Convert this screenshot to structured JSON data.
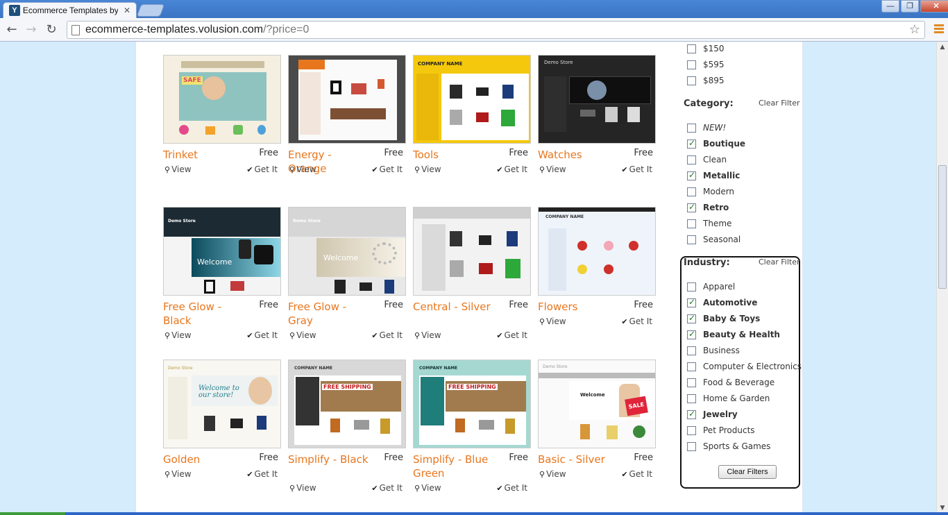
{
  "browser": {
    "tab_title": "Ecommerce Templates by Vol",
    "tab_icon": "Y",
    "tab_close": "✕",
    "url_host": "ecommerce-templates.volusion.com",
    "url_path": "/?price=0",
    "window_controls": [
      "—",
      "❐",
      "✕"
    ]
  },
  "templates": [
    {
      "name": "Trinket",
      "price": "Free",
      "view": "View",
      "getit": "Get It",
      "theme": "trinket"
    },
    {
      "name": "Energy - Orange",
      "price": "Free",
      "view": "View",
      "getit": "Get It",
      "theme": "energy"
    },
    {
      "name": "Tools",
      "price": "Free",
      "view": "View",
      "getit": "Get It",
      "theme": "tools"
    },
    {
      "name": "Watches",
      "price": "Free",
      "view": "View",
      "getit": "Get It",
      "theme": "watches"
    },
    {
      "name": "Free Glow - Black",
      "price": "Free",
      "view": "View",
      "getit": "Get It",
      "theme": "freeglow-black"
    },
    {
      "name": "Free Glow - Gray",
      "price": "Free",
      "view": "View",
      "getit": "Get It",
      "theme": "freeglow-gray"
    },
    {
      "name": "Central - Silver",
      "price": "Free",
      "view": "View",
      "getit": "Get It",
      "theme": "central"
    },
    {
      "name": "Flowers",
      "price": "Free",
      "view": "View",
      "getit": "Get It",
      "theme": "flowers"
    },
    {
      "name": "Golden",
      "price": "Free",
      "view": "View",
      "getit": "Get It",
      "theme": "golden"
    },
    {
      "name": "Simplify - Black",
      "price": "Free",
      "view": "View",
      "getit": "Get It",
      "theme": "simplify-black"
    },
    {
      "name": "Simplify - Blue Green",
      "price": "Free",
      "view": "View",
      "getit": "Get It",
      "theme": "simplify-blue"
    },
    {
      "name": "Basic - Silver",
      "price": "Free",
      "view": "View",
      "getit": "Get It",
      "theme": "basic"
    }
  ],
  "thumb_text": {
    "safe_text": "SAFE",
    "company_name": "COMPANY NAME",
    "demo_store": "Demo Store",
    "welcome": "Welcome",
    "welcome_store": "Welcome to our store!",
    "free_shipping": "FREE SHIPPING",
    "sale": "SALE"
  },
  "price_filters": [
    {
      "label": "$150",
      "checked": false
    },
    {
      "label": "$595",
      "checked": false
    },
    {
      "label": "$895",
      "checked": false
    }
  ],
  "category": {
    "heading": "Category:",
    "clear": "Clear Filter",
    "items": [
      {
        "label": "NEW!",
        "checked": false,
        "style": "italic"
      },
      {
        "label": "Boutique",
        "checked": true,
        "style": "bold"
      },
      {
        "label": "Clean",
        "checked": false,
        "style": ""
      },
      {
        "label": "Metallic",
        "checked": true,
        "style": "bold"
      },
      {
        "label": "Modern",
        "checked": false,
        "style": ""
      },
      {
        "label": "Retro",
        "checked": true,
        "style": "bold"
      },
      {
        "label": "Theme",
        "checked": false,
        "style": ""
      },
      {
        "label": "Seasonal",
        "checked": false,
        "style": ""
      }
    ]
  },
  "industry": {
    "heading": "Industry:",
    "clear": "Clear Filter",
    "items": [
      {
        "label": "Apparel",
        "checked": false,
        "style": ""
      },
      {
        "label": "Automotive",
        "checked": true,
        "style": "bold"
      },
      {
        "label": "Baby & Toys",
        "checked": true,
        "style": "bold"
      },
      {
        "label": "Beauty & Health",
        "checked": true,
        "style": "bold"
      },
      {
        "label": "Business",
        "checked": false,
        "style": ""
      },
      {
        "label": "Computer & Electronics",
        "checked": false,
        "style": ""
      },
      {
        "label": "Food & Beverage",
        "checked": false,
        "style": ""
      },
      {
        "label": "Home & Garden",
        "checked": false,
        "style": ""
      },
      {
        "label": "Jewelry",
        "checked": true,
        "style": "bold"
      },
      {
        "label": "Pet Products",
        "checked": false,
        "style": ""
      },
      {
        "label": "Sports & Games",
        "checked": false,
        "style": ""
      }
    ]
  },
  "clear_filters_label": "Clear Filters",
  "colors": {
    "accent_orange": "#e8761d",
    "check_green": "#1d7a1d",
    "page_bg": "#d4ecfb"
  }
}
